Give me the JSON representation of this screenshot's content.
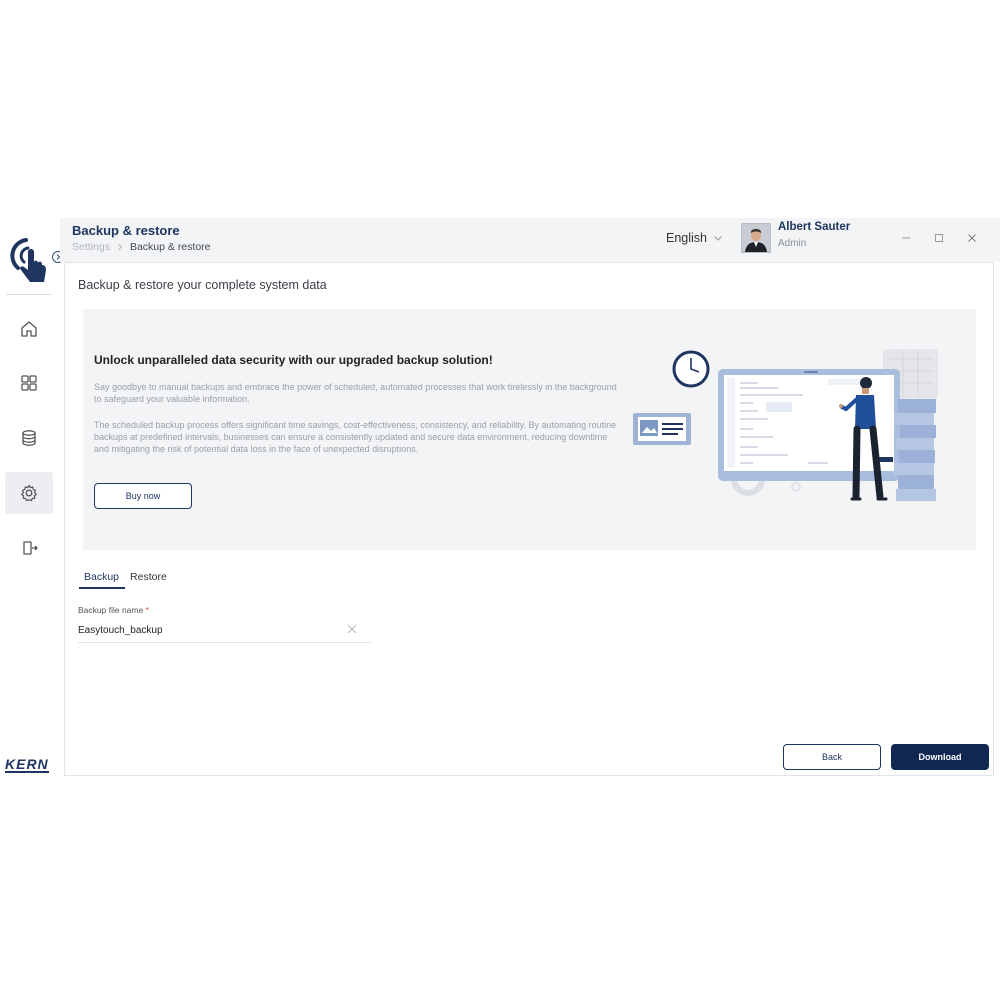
{
  "header": {
    "title": "Backup & restore",
    "breadcrumb": {
      "parent": "Settings",
      "current": "Backup & restore"
    },
    "language": "English",
    "user": {
      "name": "Albert Sauter",
      "role": "Admin"
    }
  },
  "sidebar": {
    "brand": "KERN",
    "items": [
      {
        "name": "home-icon"
      },
      {
        "name": "dashboard-grid-icon"
      },
      {
        "name": "database-icon"
      },
      {
        "name": "gear-icon",
        "active": true
      },
      {
        "name": "logout-icon"
      }
    ]
  },
  "main": {
    "section_title": "Backup & restore your complete system data",
    "promo": {
      "heading": "Unlock unparalleled data security with our upgraded backup solution!",
      "paragraph1": "Say goodbye to manual backups and embrace the power of scheduled, automated processes that work tirelessly in the background to safeguard your valuable information.",
      "paragraph2": "The scheduled backup process offers significant time savings, cost-effectiveness, consistency, and reliability. By automating routine backups at predefined intervals, businesses can ensure a consistently updated and secure data environment, reducing downtime and mitigating the risk of potential data loss in the face of unexpected disruptions.",
      "buy_label": "Buy now"
    },
    "tabs": [
      {
        "label": "Backup",
        "active": true
      },
      {
        "label": "Restore",
        "active": false
      }
    ],
    "field": {
      "label": "Backup file name",
      "required_mark": "*",
      "value": "Easytouch_backup"
    },
    "actions": {
      "back_label": "Back",
      "download_label": "Download"
    }
  },
  "colors": {
    "primary": "#1f3560",
    "primary_dark": "#0f2752",
    "panel_bg": "#f3f4f6"
  }
}
